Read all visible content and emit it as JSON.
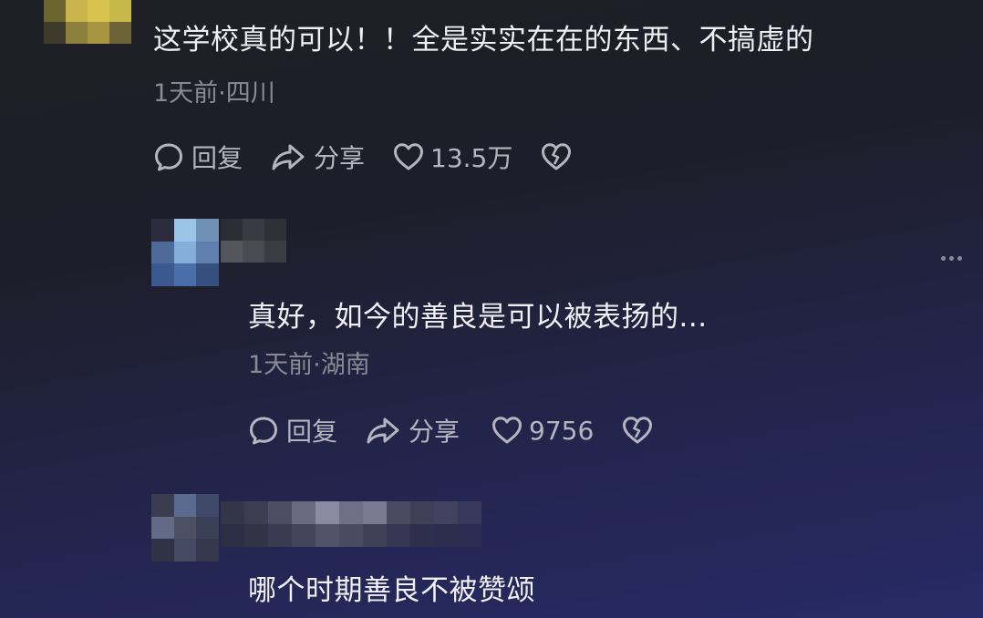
{
  "comments": [
    {
      "text": "这学校真的可以！！全是实实在在的东西、不搞虚的",
      "meta": "1天前·四川",
      "reply_label": "回复",
      "share_label": "分享",
      "like_count": "13.5万"
    },
    {
      "text": "真好，如今的善良是可以被表扬的...",
      "meta": "1天前·湖南",
      "reply_label": "回复",
      "share_label": "分享",
      "like_count": "9756"
    },
    {
      "text": "哪个时期善良不被赞颂"
    }
  ],
  "icons": {
    "reply": "comment-bubble-icon",
    "share": "share-arrow-icon",
    "like": "heart-icon",
    "dislike": "broken-heart-icon",
    "more": "more-dots-icon"
  },
  "colors": {
    "text_primary": "#f0f0f4",
    "text_secondary": "#8a8a96",
    "action": "#b5b5c0"
  }
}
